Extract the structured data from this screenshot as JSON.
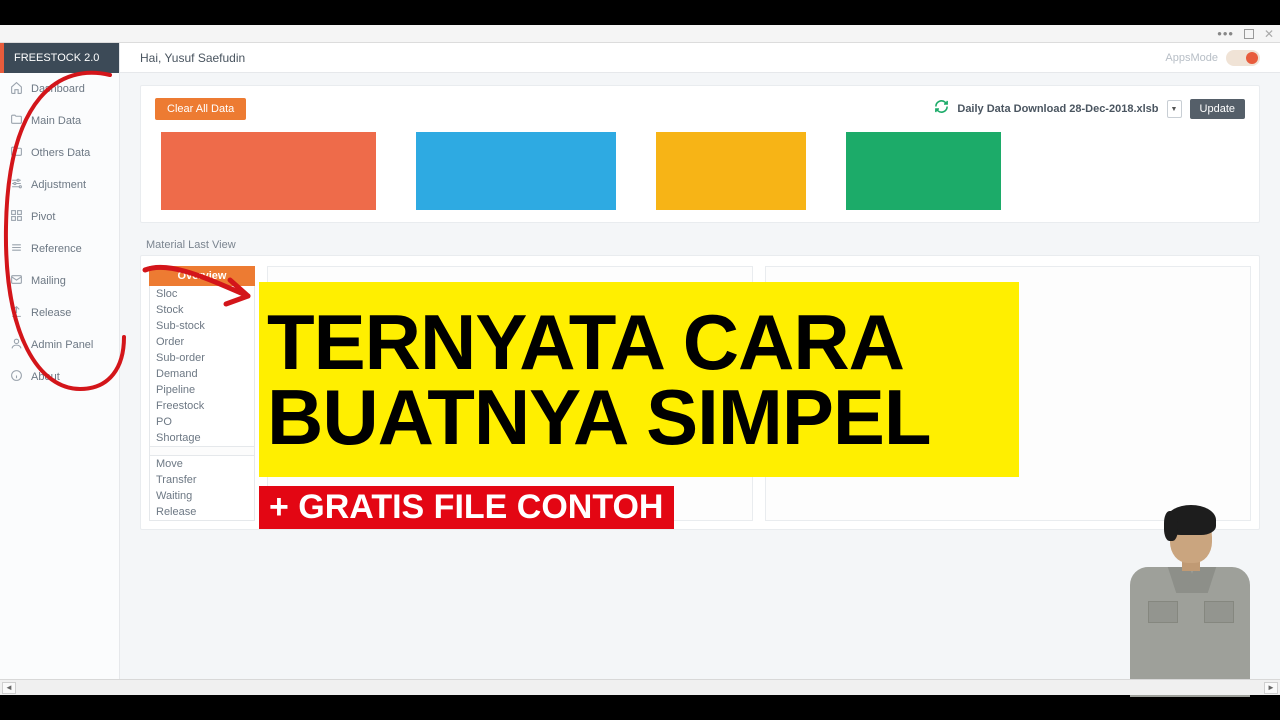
{
  "brand": "FREESTOCK 2.0",
  "sidebar": {
    "items": [
      {
        "label": "Dashboard"
      },
      {
        "label": "Main Data"
      },
      {
        "label": "Others Data"
      },
      {
        "label": "Adjustment"
      },
      {
        "label": "Pivot"
      },
      {
        "label": "Reference"
      },
      {
        "label": "Mailing"
      },
      {
        "label": "Release"
      },
      {
        "label": "Admin Panel"
      },
      {
        "label": "About"
      }
    ]
  },
  "header": {
    "greeting": "Hai, Yusuf Saefudin",
    "appsmode_label": "AppsMode"
  },
  "toolbar": {
    "clear_label": "Clear All Data",
    "download_label": "Daily Data Download 28-Dec-2018.xlsb",
    "update_label": "Update"
  },
  "tiles": {
    "colors": [
      "#ee6b4a",
      "#2eaae2",
      "#f7b416",
      "#1cab69"
    ]
  },
  "section": {
    "label": "Material Last View"
  },
  "overview": {
    "header": "Overview",
    "group1": [
      "Sloc",
      "Stock",
      "Sub-stock",
      "Order",
      "Sub-order",
      "Demand",
      "Pipeline",
      "Freestock",
      "PO",
      "Shortage"
    ],
    "group2": [
      "Move",
      "Transfer",
      "Waiting",
      "Release"
    ]
  },
  "overlay": {
    "headline_line1": "TERNYATA CARA",
    "headline_line2": "BUATNYA SIMPEL",
    "sub": "+ GRATIS FILE CONTOH"
  }
}
